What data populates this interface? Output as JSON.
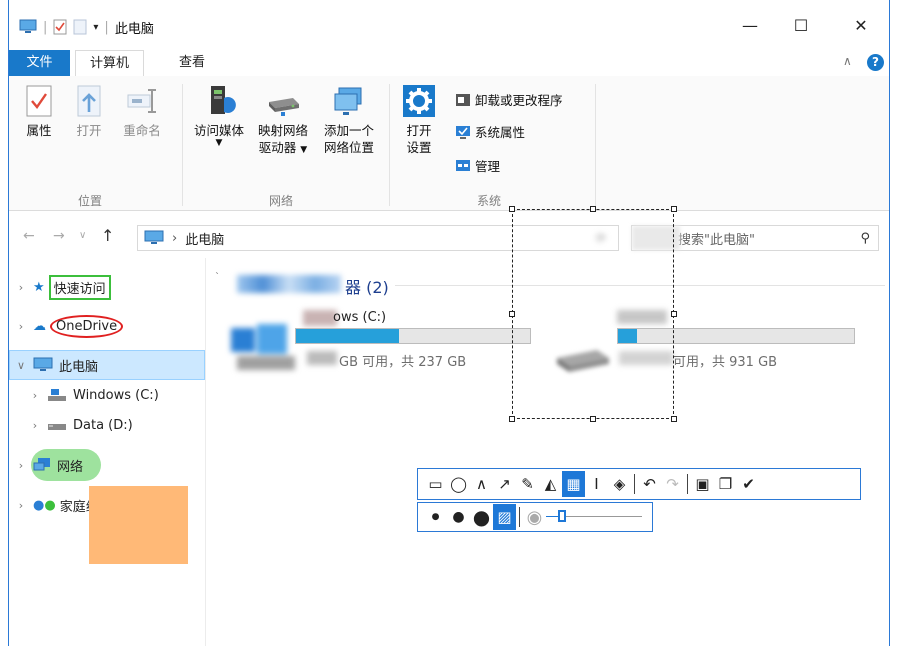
{
  "window": {
    "title": "此电脑",
    "minimize": "—",
    "maximize": "☐",
    "close": "✕"
  },
  "tabs": {
    "file": "文件",
    "computer": "计算机",
    "view": "查看",
    "collapse": "∧"
  },
  "ribbon": {
    "properties": "属性",
    "open": "打开",
    "rename": "重命名",
    "access_media": "访问媒体",
    "map_drive_1": "映射网络",
    "map_drive_2": "驱动器",
    "add_location_1": "添加一个",
    "add_location_2": "网络位置",
    "open_settings_1": "打开",
    "open_settings_2": "设置",
    "uninstall": "卸载或更改程序",
    "system_properties": "系统属性",
    "manage": "管理",
    "group_location": "位置",
    "group_network": "网络",
    "group_system": "系统"
  },
  "address": {
    "path": "此电脑",
    "search_placeholder": "搜索\"此电脑\""
  },
  "nav": {
    "quick_access": "快速访问",
    "onedrive": "OneDrive",
    "this_pc": "此电脑",
    "windows_c": "Windows (C:)",
    "data_d": "Data (D:)",
    "network": "网络",
    "homegroup": "家庭组"
  },
  "content": {
    "section_title": "器 (2)",
    "drive_c_name": "ows (C:)",
    "drive_c_free": "GB 可用，共 237 GB",
    "drive_c_fill": 0.44,
    "drive_d_free": "可用，共 931 GB",
    "drive_d_fill": 0.08
  },
  "colors": {
    "accent": "#1979ca",
    "selection": "#cce8ff",
    "drive_fill": "#26a0da",
    "highlight_orange": "#ffb977",
    "highlight_green": "#9ee29e"
  }
}
